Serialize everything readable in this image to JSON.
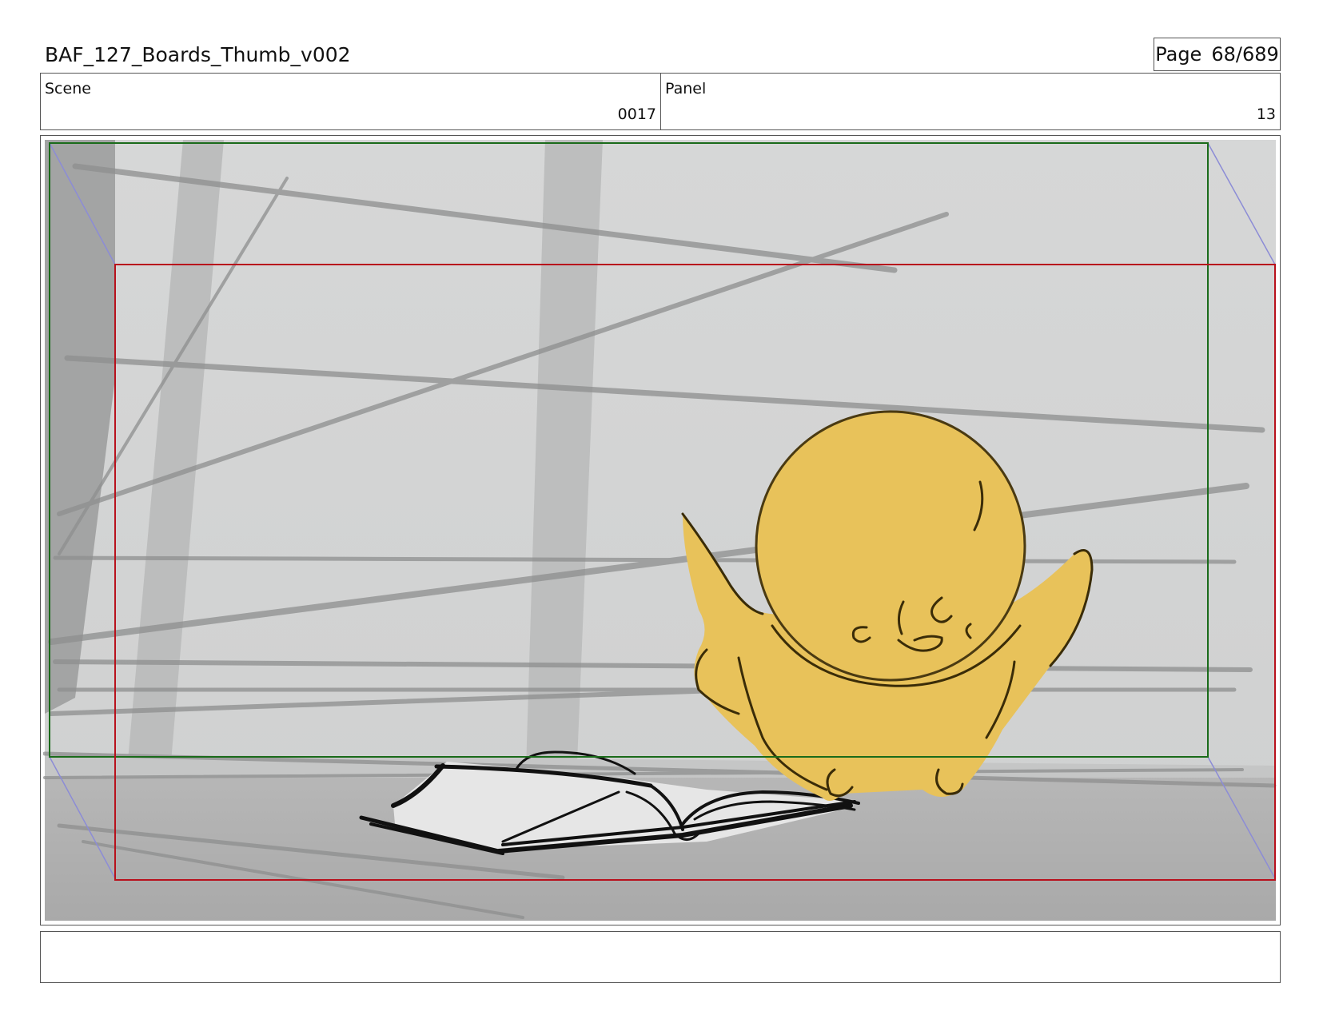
{
  "header": {
    "document_title": "BAF_127_Boards_Thumb_v002",
    "page_label": "Page",
    "page_number": "68/689"
  },
  "info": {
    "scene_label": "Scene",
    "scene_value": "0017",
    "panel_label": "Panel",
    "panel_value": "13"
  },
  "frame": {
    "safe_frame_color": "#1a6b1a",
    "action_frame_color": "#b8111c",
    "character_color": "#e8c25a"
  },
  "notes": {
    "text": ""
  }
}
